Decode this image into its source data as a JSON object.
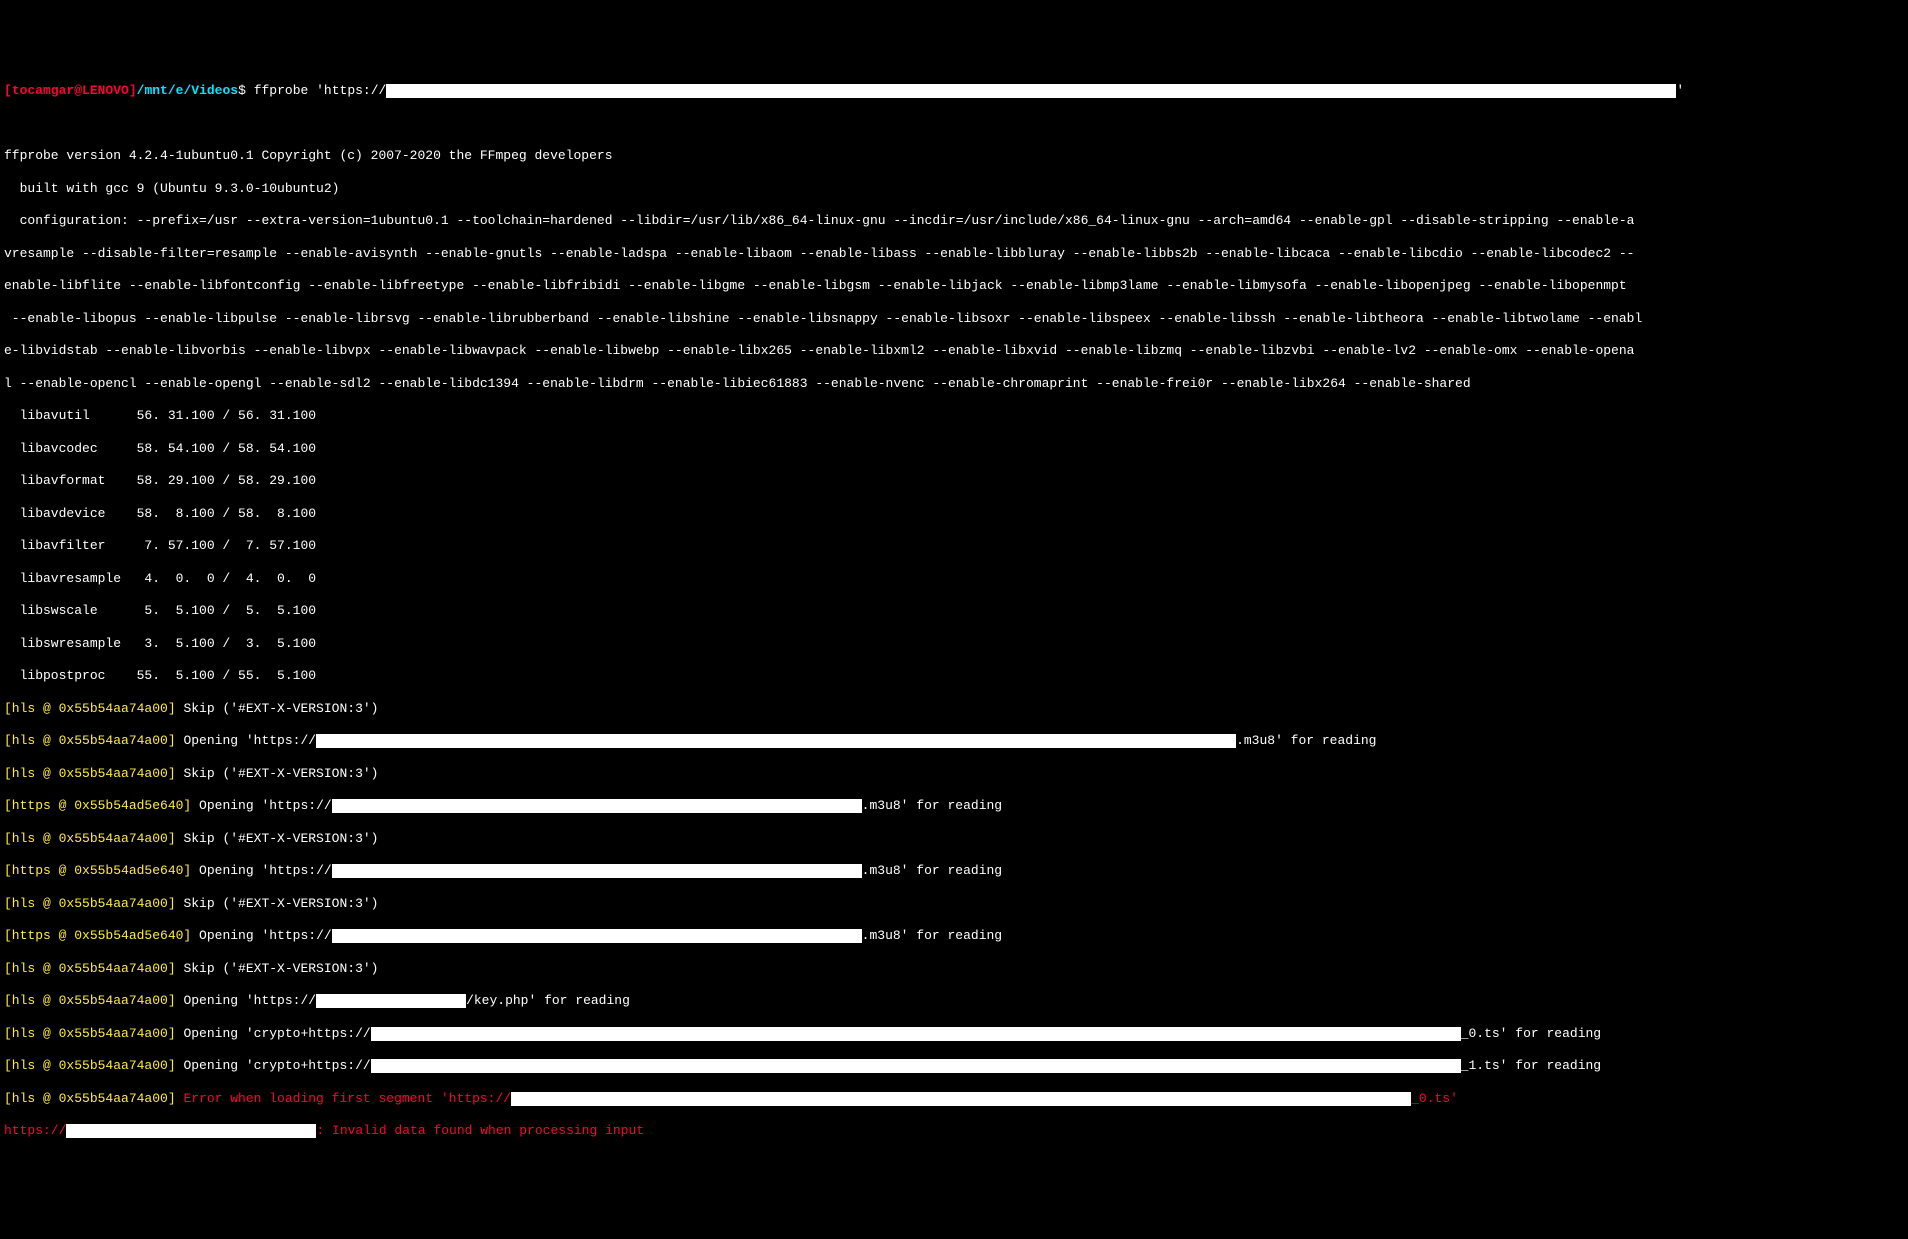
{
  "prompt": {
    "user": "tocamgar@LENOVO",
    "bracket_open": "[",
    "bracket_close": "]",
    "path": "/mnt/e/Videos",
    "dollar": "$",
    "command": "ffprobe 'https://",
    "command_end": "'"
  },
  "header": {
    "version_line": "ffprobe version 4.2.4-1ubuntu0.1 Copyright (c) 2007-2020 the FFmpeg developers",
    "built_line": "  built with gcc 9 (Ubuntu 9.3.0-10ubuntu2)",
    "config1": "  configuration: --prefix=/usr --extra-version=1ubuntu0.1 --toolchain=hardened --libdir=/usr/lib/x86_64-linux-gnu --incdir=/usr/include/x86_64-linux-gnu --arch=amd64 --enable-gpl --disable-stripping --enable-a",
    "config2": "vresample --disable-filter=resample --enable-avisynth --enable-gnutls --enable-ladspa --enable-libaom --enable-libass --enable-libbluray --enable-libbs2b --enable-libcaca --enable-libcdio --enable-libcodec2 --",
    "config3": "enable-libflite --enable-libfontconfig --enable-libfreetype --enable-libfribidi --enable-libgme --enable-libgsm --enable-libjack --enable-libmp3lame --enable-libmysofa --enable-libopenjpeg --enable-libopenmpt",
    "config4": " --enable-libopus --enable-libpulse --enable-librsvg --enable-librubberband --enable-libshine --enable-libsnappy --enable-libsoxr --enable-libspeex --enable-libssh --enable-libtheora --enable-libtwolame --enabl",
    "config5": "e-libvidstab --enable-libvorbis --enable-libvpx --enable-libwavpack --enable-libwebp --enable-libx265 --enable-libxml2 --enable-libxvid --enable-libzmq --enable-libzvbi --enable-lv2 --enable-omx --enable-opena",
    "config6": "l --enable-opencl --enable-opengl --enable-sdl2 --enable-libdc1394 --enable-libdrm --enable-libiec61883 --enable-nvenc --enable-chromaprint --enable-frei0r --enable-libx264 --enable-shared"
  },
  "libs": {
    "avutil": "  libavutil      56. 31.100 / 56. 31.100",
    "avcodec": "  libavcodec     58. 54.100 / 58. 54.100",
    "avformat": "  libavformat    58. 29.100 / 58. 29.100",
    "avdevice": "  libavdevice    58.  8.100 / 58.  8.100",
    "avfilter": "  libavfilter     7. 57.100 /  7. 57.100",
    "avresample": "  libavresample   4.  0.  0 /  4.  0.  0",
    "swscale": "  libswscale      5.  5.100 /  5.  5.100",
    "swresample": "  libswresample   3.  5.100 /  3.  5.100",
    "postproc": "  libpostproc    55.  5.100 / 55.  5.100"
  },
  "hls": {
    "tag_hls": "[hls @ 0x55b54aa74a00] ",
    "tag_https": "[https @ 0x55b54ad5e640] ",
    "skip": "Skip ('#EXT-X-VERSION:3')",
    "open_https": "Opening 'https://",
    "m3u8_suffix": ".m3u8' for reading",
    "key_suffix": "/key.php' for reading",
    "open_crypto": "Opening 'crypto+https://",
    "ts0_suffix": "_0.ts' for reading",
    "ts1_suffix": "_1.ts' for reading",
    "error_seg": "Error when loading first segment 'https://",
    "error_seg_end": "_0.ts'",
    "https_prefix": "https://",
    "invalid": ": Invalid data found when processing input"
  },
  "redacted_widths": {
    "cmd": 1290,
    "hls_open1": 920,
    "https_open": 530,
    "key": 150,
    "crypto": 1090,
    "err_seg": 900,
    "final": 250
  }
}
